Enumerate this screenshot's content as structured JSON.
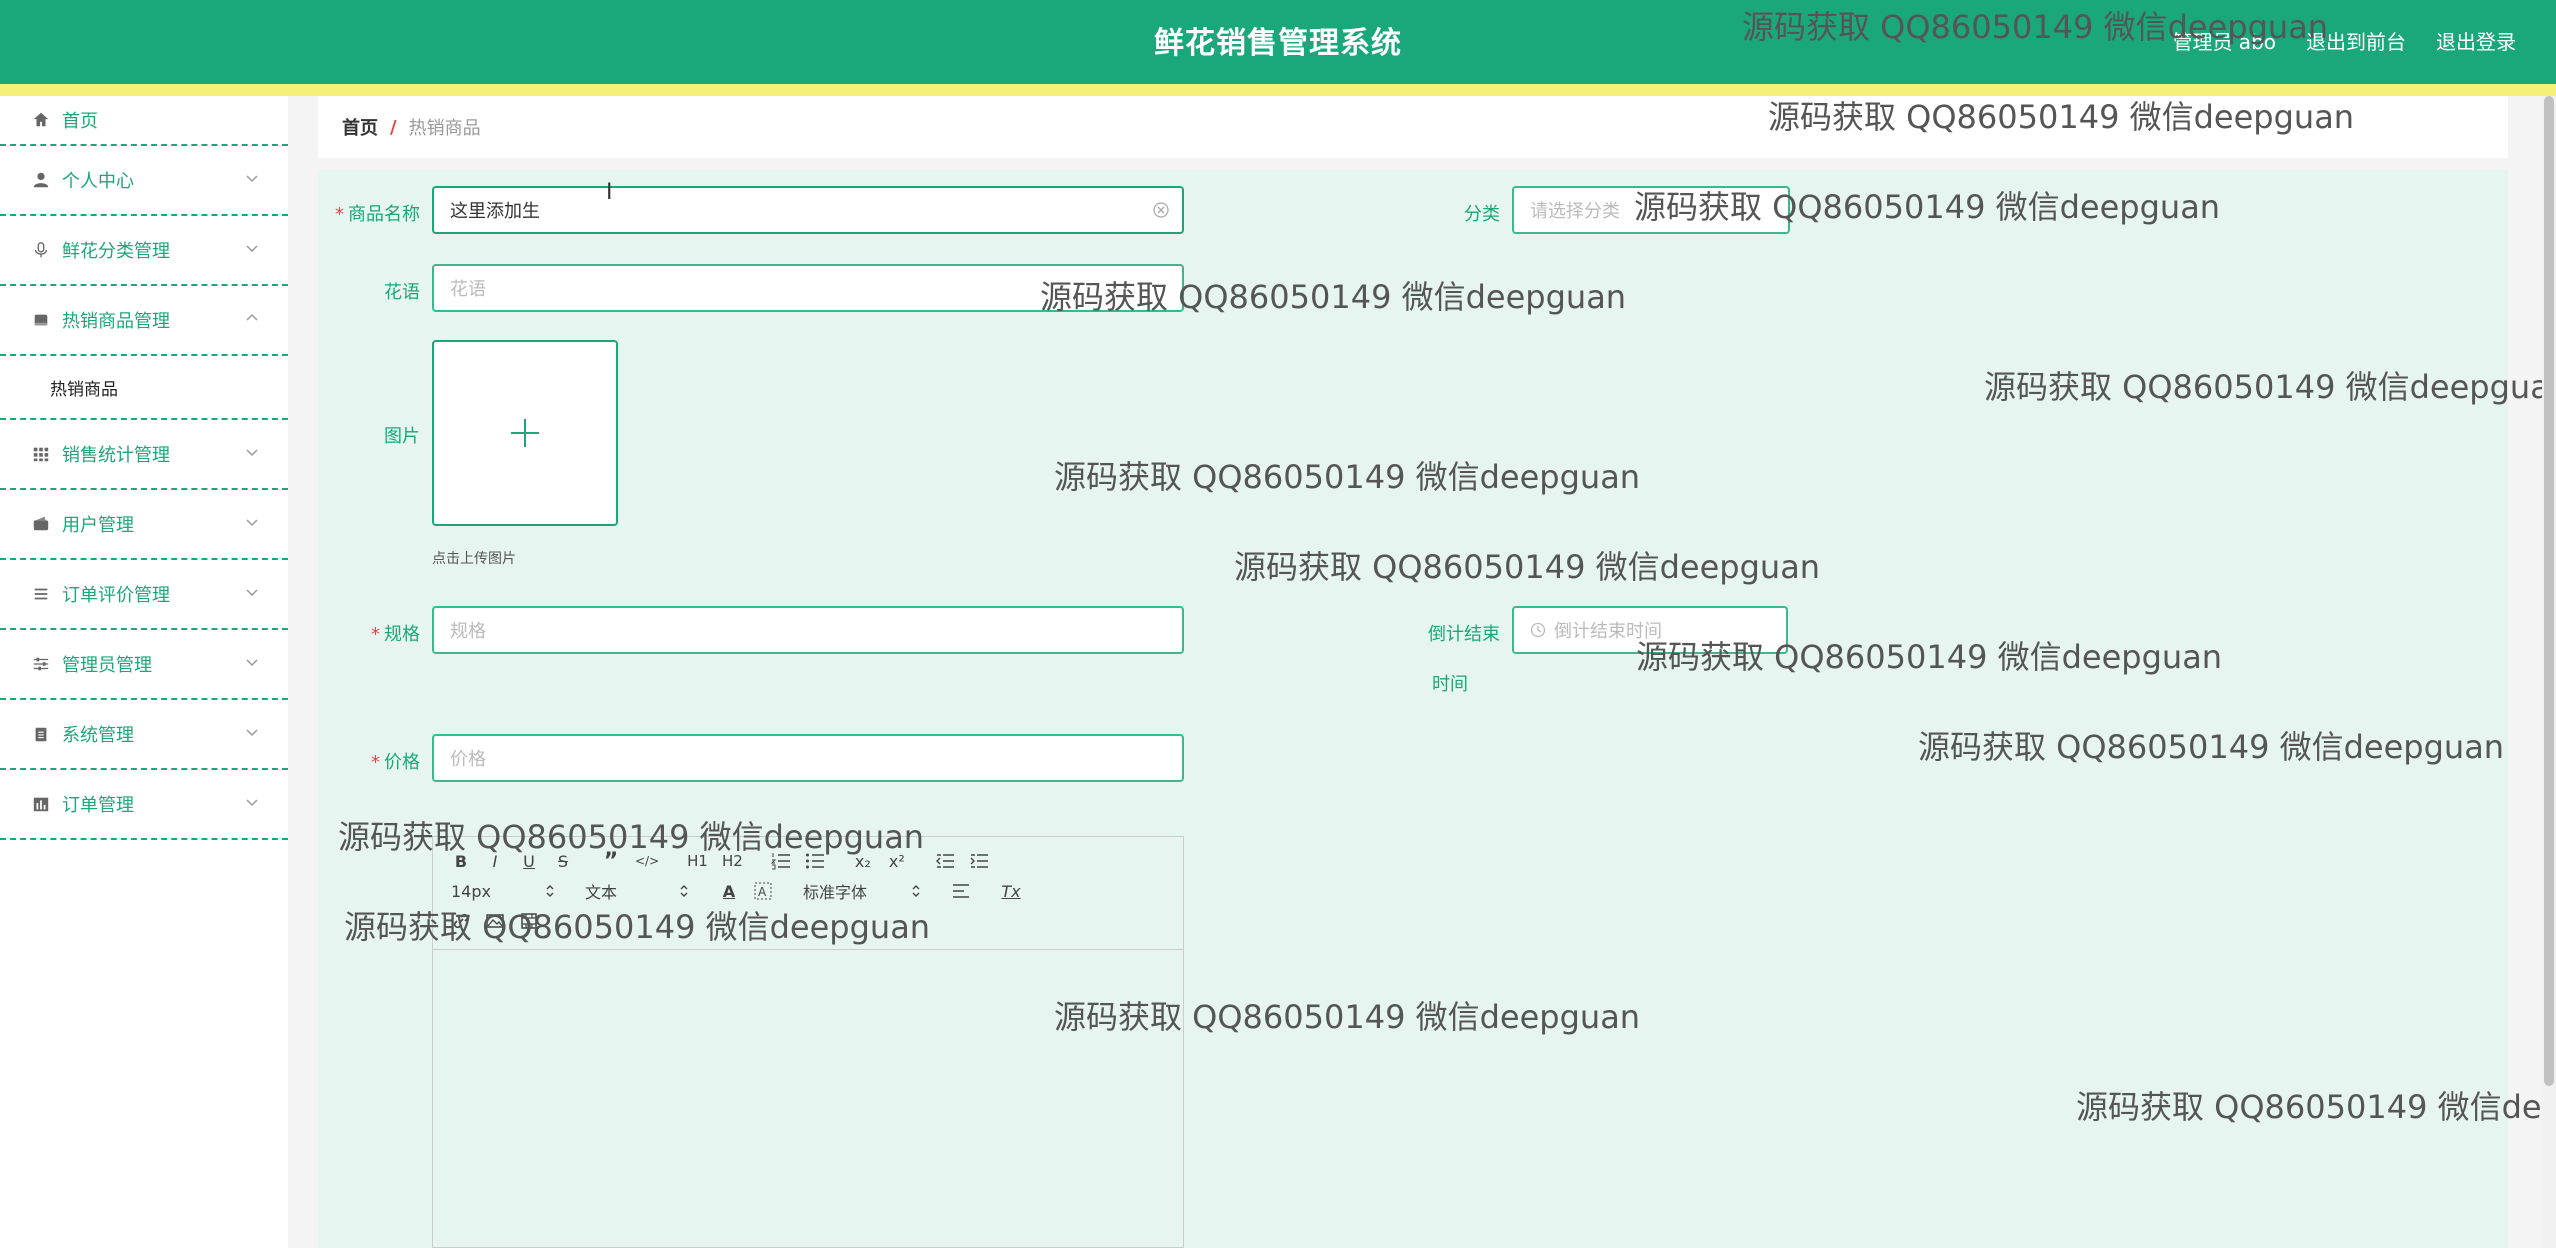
{
  "header": {
    "title": "鲜花销售管理系统",
    "user_label": "管理员 abo",
    "back_to_front": "退出到前台",
    "logout": "退出登录"
  },
  "sidebar": {
    "items": [
      {
        "label": "首页",
        "icon": "home-icon"
      },
      {
        "label": "个人中心",
        "icon": "user-icon"
      },
      {
        "label": "鲜花分类管理",
        "icon": "microphone-icon"
      },
      {
        "label": "热销商品管理",
        "icon": "bookmark-icon",
        "expanded": true
      },
      {
        "label": "销售统计管理",
        "icon": "grid-icon"
      },
      {
        "label": "用户管理",
        "icon": "wallet-icon"
      },
      {
        "label": "订单评价管理",
        "icon": "list-icon"
      },
      {
        "label": "管理员管理",
        "icon": "sliders-icon"
      },
      {
        "label": "系统管理",
        "icon": "clipboard-icon"
      },
      {
        "label": "订单管理",
        "icon": "chart-icon"
      }
    ],
    "submenu": {
      "label": "热销商品"
    }
  },
  "breadcrumb": {
    "home": "首页",
    "sep": "/",
    "current": "热销商品"
  },
  "form": {
    "name_label": "商品名称",
    "name_value": "这里添加生",
    "category_label": "分类",
    "category_placeholder": "请选择分类",
    "flower_language_label": "花语",
    "flower_language_placeholder": "花语",
    "image_label": "图片",
    "upload_hint": "点击上传图片",
    "spec_label": "规格",
    "spec_placeholder": "规格",
    "countdown_label_1": "倒计结束",
    "countdown_label_2": "时间",
    "countdown_placeholder": "倒计结束时间",
    "price_label": "价格",
    "price_placeholder": "价格",
    "required_mark": "*"
  },
  "editor": {
    "font_size": "14px",
    "format": "文本",
    "font_family": "标准字体",
    "buttons": [
      "B",
      "I",
      "U",
      "S",
      "”",
      "</>",
      "H1",
      "H2",
      "list-ordered",
      "list-bullet",
      "x₂",
      "x²",
      "outdent",
      "indent"
    ]
  },
  "watermark_text": "源码获取 QQ86050149 微信deepguan",
  "watermark_partial": "源码获取 QQ86050149 微信deepg",
  "colors": {
    "primary": "#1aa87a",
    "accent_strip": "#f4f07a",
    "required": "#e04646",
    "form_bg": "#e6f5ef"
  }
}
